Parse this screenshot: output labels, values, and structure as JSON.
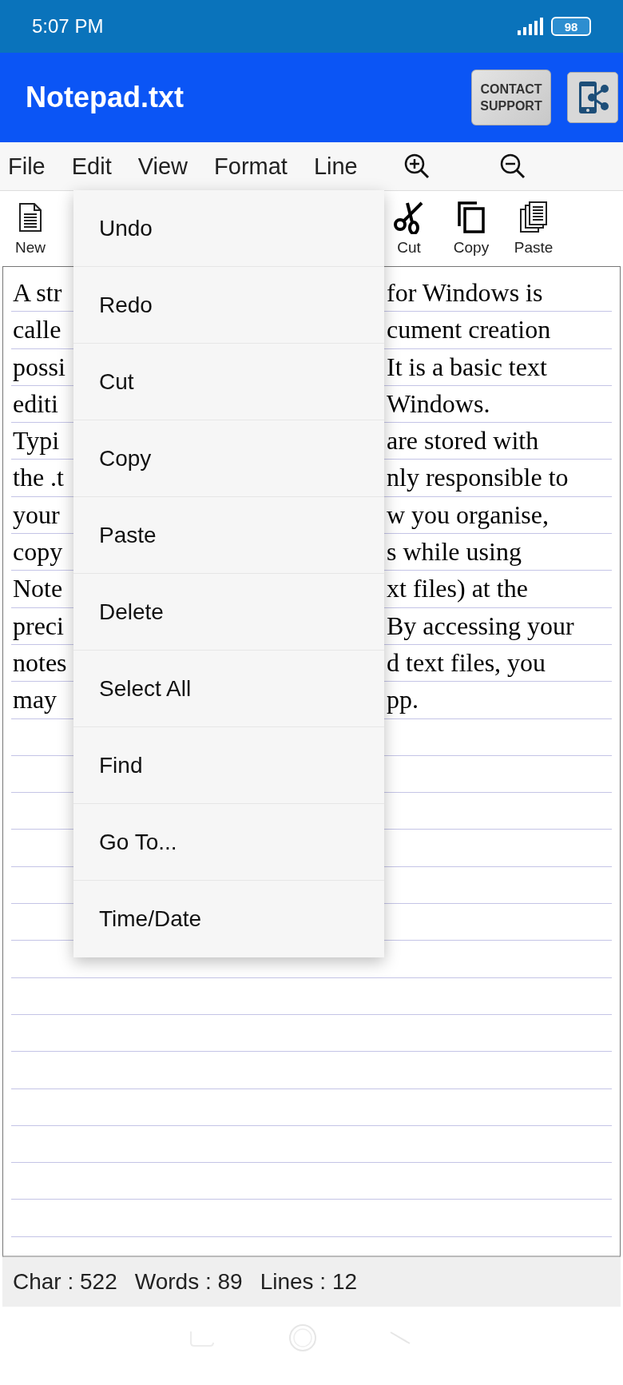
{
  "status_bar": {
    "time": "5:07 PM",
    "battery": "98"
  },
  "app_bar": {
    "title": "Notepad.txt",
    "contact_button": "CONTACT\nSUPPORT"
  },
  "menu_bar": [
    {
      "label": "File"
    },
    {
      "label": "Edit"
    },
    {
      "label": "View"
    },
    {
      "label": "Format"
    },
    {
      "label": "Line"
    }
  ],
  "toolbar": [
    {
      "kind": "new",
      "label": "New"
    },
    {
      "kind": "cut",
      "label": "Cut"
    },
    {
      "kind": "copy",
      "label": "Copy"
    },
    {
      "kind": "paste",
      "label": "Paste"
    }
  ],
  "document_lines": [
    {
      "left": "A str",
      "right": "for Windows is"
    },
    {
      "left": "calle",
      "right": "cument creation"
    },
    {
      "left": "possi",
      "right": "It is a basic text"
    },
    {
      "left": "editi",
      "right": "Windows."
    },
    {
      "left": "Typi",
      "right": "are stored with"
    },
    {
      "left": "the .t",
      "right": "nly responsible to"
    },
    {
      "left": "your",
      "right": "w you organise,"
    },
    {
      "left": "copy",
      "right": "s while using"
    },
    {
      "left": "Note",
      "right": "xt files) at the"
    },
    {
      "left": "preci",
      "right": "By accessing your"
    },
    {
      "left": "notes",
      "right": "d text files, you"
    },
    {
      "left": "may",
      "right": "pp."
    }
  ],
  "edit_menu": [
    "Undo",
    "Redo",
    "Cut",
    "Copy",
    "Paste",
    "Delete",
    "Select All",
    "Find",
    "Go To...",
    "Time/Date"
  ],
  "footer": [
    "Char : 522",
    "Words : 89",
    "Lines : 12"
  ]
}
